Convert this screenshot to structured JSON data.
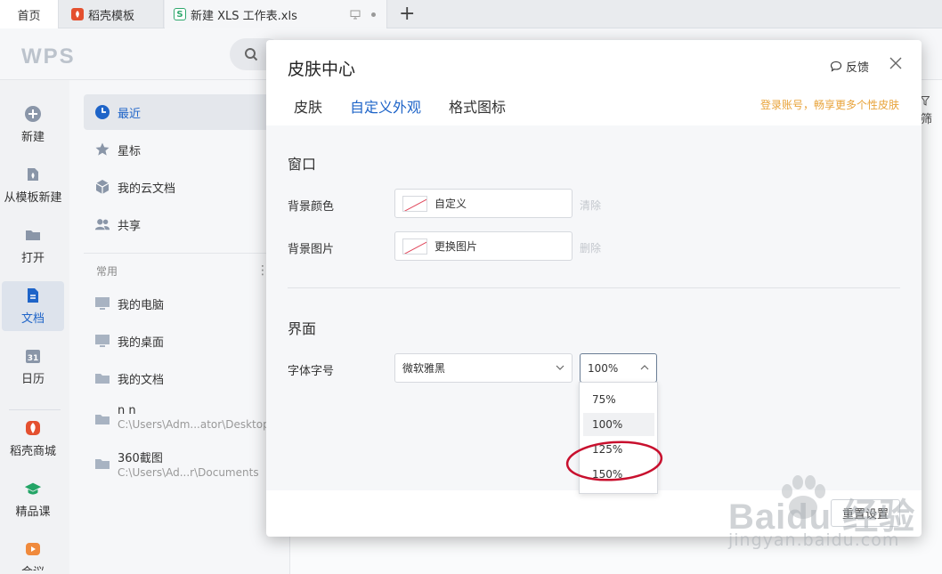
{
  "tabs": {
    "home": "首页",
    "template": "稻壳模板",
    "file": "新建 XLS 工作表.xls",
    "add": "+"
  },
  "header": {
    "logo": "WPS"
  },
  "leftnav": {
    "items": [
      {
        "label": "新建",
        "icon": "plus-circle-icon"
      },
      {
        "label": "从模板新建",
        "icon": "template-icon"
      },
      {
        "label": "打开",
        "icon": "folder-icon"
      },
      {
        "label": "文档",
        "icon": "document-icon"
      },
      {
        "label": "日历",
        "icon": "calendar-icon"
      },
      {
        "label": "稻壳商城",
        "icon": "daoke-icon"
      },
      {
        "label": "精品课",
        "icon": "course-icon"
      },
      {
        "label": "会议",
        "icon": "meeting-icon"
      }
    ]
  },
  "filepanel": {
    "items": [
      {
        "label": "最近",
        "icon": "clock-icon"
      },
      {
        "label": "星标",
        "icon": "star-icon"
      },
      {
        "label": "我的云文档",
        "icon": "cloud-cube-icon"
      },
      {
        "label": "共享",
        "icon": "people-icon"
      }
    ],
    "section": "常用",
    "kebab": "⋮",
    "entries": [
      {
        "label": "我的电脑",
        "path": ""
      },
      {
        "label": "我的桌面",
        "path": ""
      },
      {
        "label": "我的文档",
        "path": ""
      },
      {
        "label": "n n",
        "path": "C:\\Users\\Adm...ator\\Desktop"
      },
      {
        "label": "360截图",
        "path": "C:\\Users\\Ad...r\\Documents"
      }
    ]
  },
  "main": {
    "filter_fragment": "筛"
  },
  "dialog": {
    "title": "皮肤中心",
    "feedback": "反馈",
    "tabs": [
      "皮肤",
      "自定义外观",
      "格式图标"
    ],
    "active_tab": "自定义外观",
    "promo": "登录账号，畅享更多个性皮肤",
    "window_section": "窗口",
    "bg_color_label": "背景颜色",
    "bg_color_value": "自定义",
    "bg_color_clear": "清除",
    "bg_image_label": "背景图片",
    "bg_image_value": "更换图片",
    "bg_image_delete": "删除",
    "ui_section": "界面",
    "font_label": "字体字号",
    "font_value": "微软雅黑",
    "size_value": "100%",
    "size_options": [
      "75%",
      "100%",
      "125%",
      "150%"
    ],
    "reset": "重置设置"
  },
  "watermark": {
    "brand": "Baidu 经验",
    "sub": "jingyan.baidu.com"
  },
  "colors": {
    "accent": "#1e64c8",
    "promo": "#e8a33a",
    "annotation": "#c8102e"
  }
}
